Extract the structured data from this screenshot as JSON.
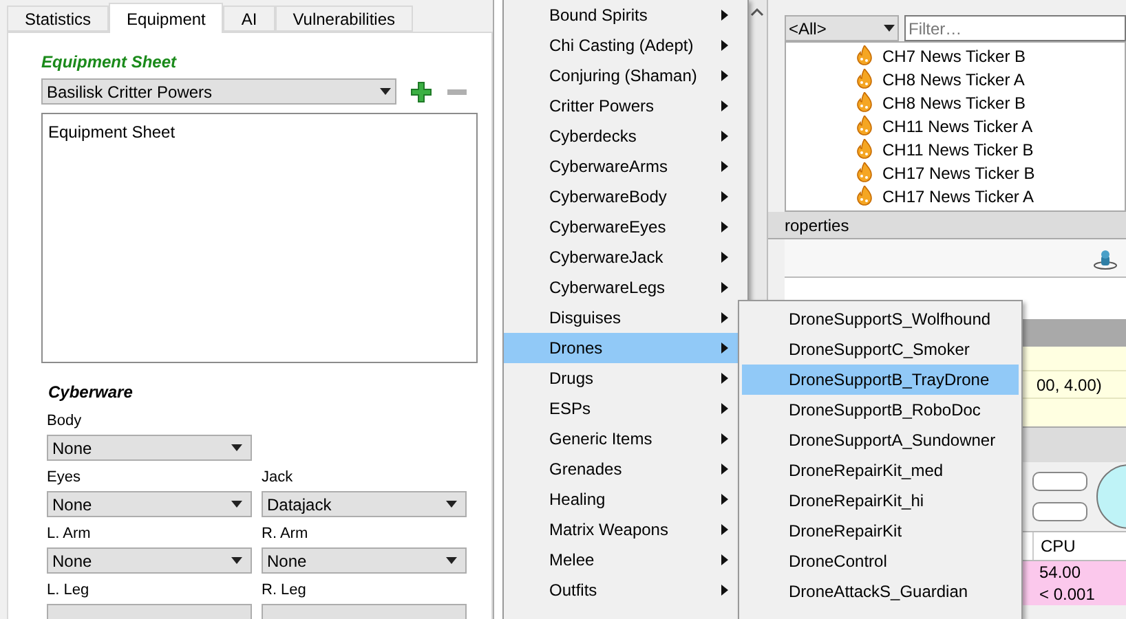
{
  "tabs": [
    {
      "label": "Statistics",
      "selected": false
    },
    {
      "label": "Equipment",
      "selected": true
    },
    {
      "label": "AI",
      "selected": false
    },
    {
      "label": "Vulnerabilities",
      "selected": false
    }
  ],
  "equipment_sheet": {
    "heading": "Equipment Sheet",
    "selected_sheet": "Basilisk Critter Powers",
    "items": [
      "Equipment Sheet"
    ]
  },
  "cyberware": {
    "heading": "Cyberware",
    "rows": [
      [
        {
          "label": "Body",
          "value": "None"
        }
      ],
      [
        {
          "label": "Eyes",
          "value": "None"
        },
        {
          "label": "Jack",
          "value": "Datajack"
        }
      ],
      [
        {
          "label": "L. Arm",
          "value": "None"
        },
        {
          "label": "R. Arm",
          "value": "None"
        }
      ],
      [
        {
          "label": "L. Leg"
        },
        {
          "label": "R. Leg"
        }
      ]
    ]
  },
  "scene_contents": {
    "type_filter": "<All>",
    "filter_placeholder": "Filter…",
    "items": [
      "CH7 News Ticker B",
      "CH8 News Ticker A",
      "CH8 News Ticker B",
      "CH11 News Ticker A",
      "CH11 News Ticker B",
      "CH17 News Ticker B",
      "CH17 News Ticker A"
    ]
  },
  "properties": {
    "heading": "roperties",
    "value_fragment": "00, 4.00)"
  },
  "stats_table": {
    "columns": [
      "CPU"
    ],
    "rows": [
      [
        "54.00"
      ],
      [
        "< 0.001"
      ]
    ]
  },
  "context_menu": {
    "items": [
      {
        "label": "Bound Spirits",
        "selected": false
      },
      {
        "label": "Chi Casting (Adept)",
        "selected": false
      },
      {
        "label": "Conjuring (Shaman)",
        "selected": false
      },
      {
        "label": "Critter Powers",
        "selected": false
      },
      {
        "label": "Cyberdecks",
        "selected": false
      },
      {
        "label": "CyberwareArms",
        "selected": false
      },
      {
        "label": "CyberwareBody",
        "selected": false
      },
      {
        "label": "CyberwareEyes",
        "selected": false
      },
      {
        "label": "CyberwareJack",
        "selected": false
      },
      {
        "label": "CyberwareLegs",
        "selected": false
      },
      {
        "label": "Disguises",
        "selected": false
      },
      {
        "label": "Drones",
        "selected": true
      },
      {
        "label": "Drugs",
        "selected": false
      },
      {
        "label": "ESPs",
        "selected": false
      },
      {
        "label": "Generic Items",
        "selected": false
      },
      {
        "label": "Grenades",
        "selected": false
      },
      {
        "label": "Healing",
        "selected": false
      },
      {
        "label": "Matrix Weapons",
        "selected": false
      },
      {
        "label": "Melee",
        "selected": false
      },
      {
        "label": "Outfits",
        "selected": false
      }
    ]
  },
  "submenu": {
    "items": [
      {
        "label": "DroneSupportS_Wolfhound",
        "selected": false
      },
      {
        "label": "DroneSupportC_Smoker",
        "selected": false
      },
      {
        "label": "DroneSupportB_TrayDrone",
        "selected": true
      },
      {
        "label": "DroneSupportB_RoboDoc",
        "selected": false
      },
      {
        "label": "DroneSupportA_Sundowner",
        "selected": false
      },
      {
        "label": "DroneRepairKit_med",
        "selected": false
      },
      {
        "label": "DroneRepairKit_hi",
        "selected": false
      },
      {
        "label": "DroneRepairKit",
        "selected": false
      },
      {
        "label": "DroneControl",
        "selected": false
      },
      {
        "label": "DroneAttackS_Guardian",
        "selected": false
      }
    ]
  }
}
